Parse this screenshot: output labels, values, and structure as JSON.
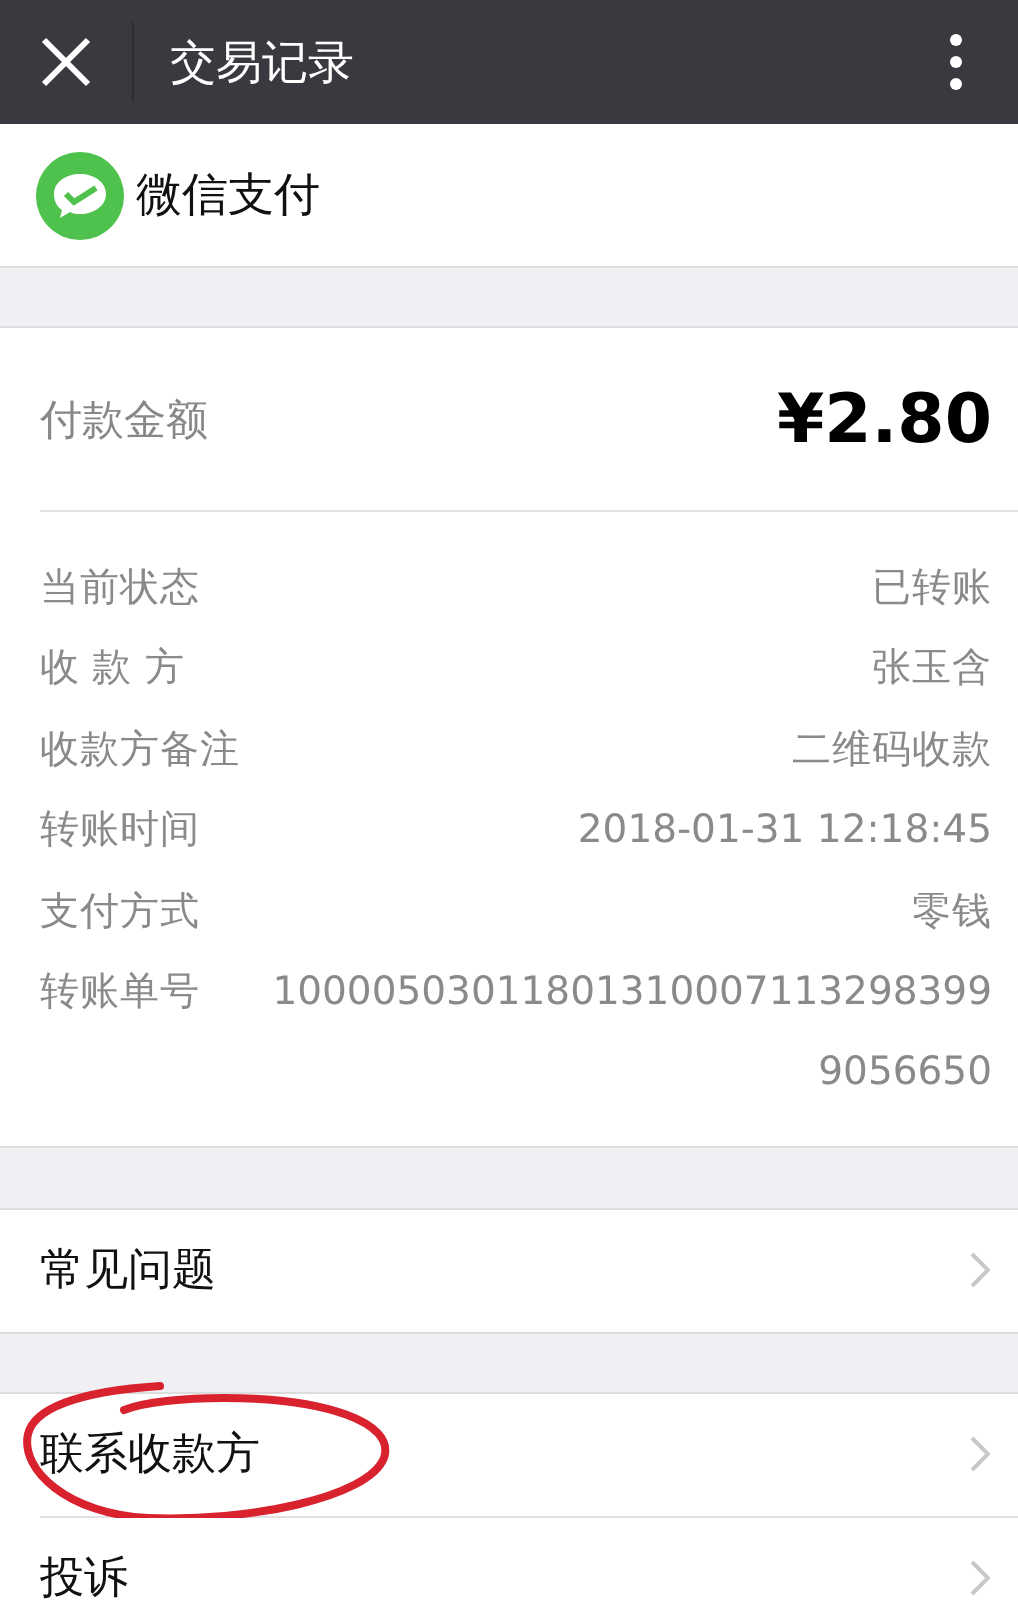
{
  "header": {
    "title": "交易记录"
  },
  "brand": {
    "name": "微信支付"
  },
  "payment": {
    "amount_label": "付款金额",
    "amount": "¥2.80",
    "details": [
      {
        "label": "当前状态",
        "value": "已转账"
      },
      {
        "label": "收 款 方",
        "value": "张玉含"
      },
      {
        "label": "收款方备注",
        "value": "二维码收款"
      },
      {
        "label": "转账时间",
        "value": "2018-01-31 12:18:45"
      },
      {
        "label": "支付方式",
        "value": "零钱"
      },
      {
        "label": "转账单号",
        "value": "100005030118013100071132983999056650"
      }
    ]
  },
  "menu_groups": [
    [
      {
        "label": "常见问题",
        "circled": false
      }
    ],
    [
      {
        "label": "联系收款方",
        "circled": true
      },
      {
        "label": "投诉",
        "circled": false
      }
    ]
  ]
}
